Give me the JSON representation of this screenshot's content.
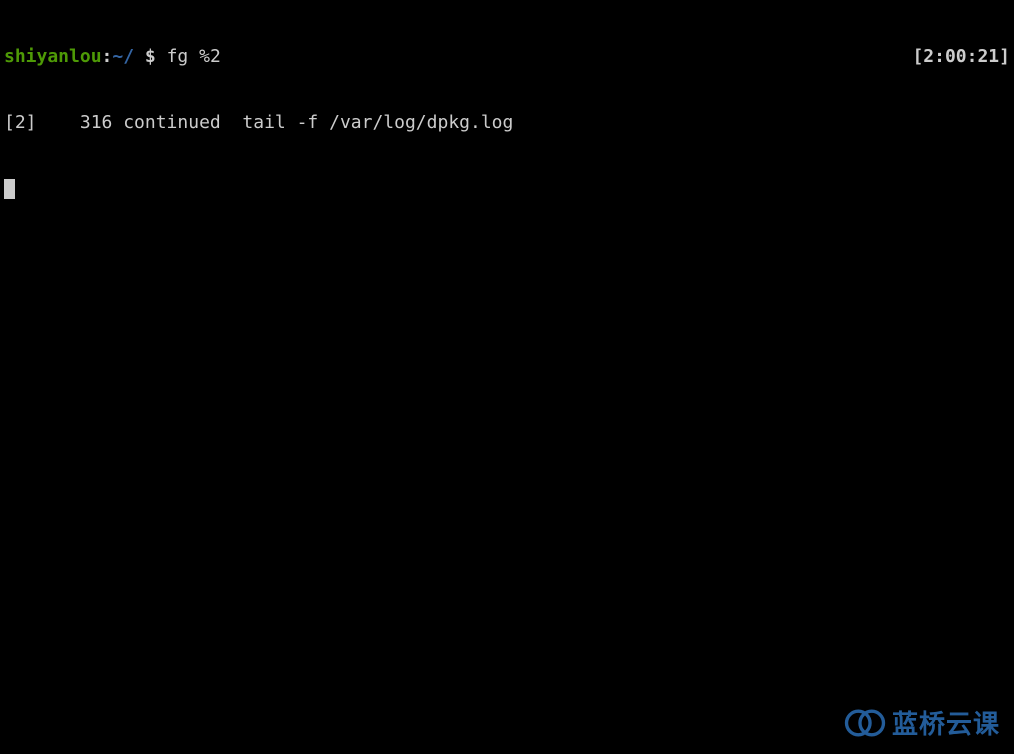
{
  "prompt": {
    "user": "shiyanlou",
    "separator": ":",
    "cwd": "~/",
    "symbol": " $ ",
    "command": "fg %2",
    "timestamp": "[2:00:21]"
  },
  "output": {
    "line1": "[2]    316 continued  tail -f /var/log/dpkg.log"
  },
  "watermark": {
    "text": "蓝桥云课"
  }
}
